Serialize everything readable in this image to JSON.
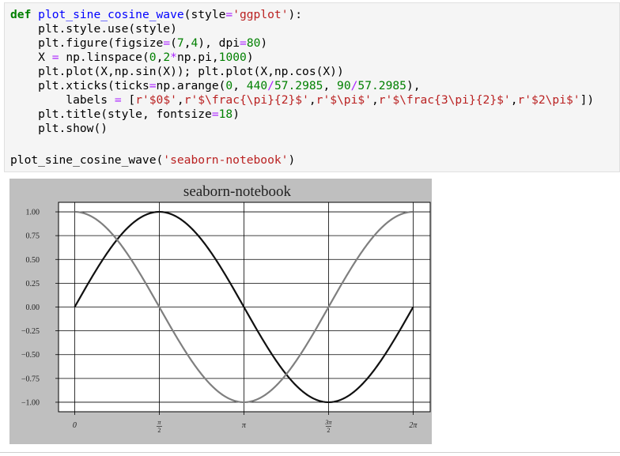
{
  "code_cell": {
    "lines": [
      {
        "indent": "",
        "parts": [
          {
            "cls": "kw",
            "text": "def"
          },
          {
            "cls": "",
            "text": " "
          },
          {
            "cls": "fn",
            "text": "plot_sine_cosine_wave"
          },
          {
            "cls": "",
            "text": "(style"
          },
          {
            "cls": "op",
            "text": "="
          },
          {
            "cls": "str",
            "text": "'ggplot'"
          },
          {
            "cls": "",
            "text": "):"
          }
        ]
      },
      {
        "indent": "    ",
        "parts": [
          {
            "cls": "",
            "text": "plt.style.use(style)"
          }
        ]
      },
      {
        "indent": "    ",
        "parts": [
          {
            "cls": "",
            "text": "plt.figure(figsize"
          },
          {
            "cls": "op",
            "text": "="
          },
          {
            "cls": "",
            "text": "("
          },
          {
            "cls": "num",
            "text": "7"
          },
          {
            "cls": "",
            "text": ","
          },
          {
            "cls": "num",
            "text": "4"
          },
          {
            "cls": "",
            "text": "), dpi"
          },
          {
            "cls": "op",
            "text": "="
          },
          {
            "cls": "num",
            "text": "80"
          },
          {
            "cls": "",
            "text": ")"
          }
        ]
      },
      {
        "indent": "    ",
        "parts": [
          {
            "cls": "",
            "text": "X "
          },
          {
            "cls": "op",
            "text": "="
          },
          {
            "cls": "",
            "text": " np.linspace("
          },
          {
            "cls": "num",
            "text": "0"
          },
          {
            "cls": "",
            "text": ","
          },
          {
            "cls": "num",
            "text": "2"
          },
          {
            "cls": "op",
            "text": "*"
          },
          {
            "cls": "",
            "text": "np.pi,"
          },
          {
            "cls": "num",
            "text": "1000"
          },
          {
            "cls": "",
            "text": ")"
          }
        ]
      },
      {
        "indent": "    ",
        "parts": [
          {
            "cls": "",
            "text": "plt.plot(X,np.sin(X)); plt.plot(X,np.cos(X))"
          }
        ]
      },
      {
        "indent": "    ",
        "parts": [
          {
            "cls": "",
            "text": "plt.xticks(ticks"
          },
          {
            "cls": "op",
            "text": "="
          },
          {
            "cls": "",
            "text": "np.arange("
          },
          {
            "cls": "num",
            "text": "0"
          },
          {
            "cls": "",
            "text": ", "
          },
          {
            "cls": "num",
            "text": "440"
          },
          {
            "cls": "op",
            "text": "/"
          },
          {
            "cls": "num",
            "text": "57.2985"
          },
          {
            "cls": "",
            "text": ", "
          },
          {
            "cls": "num",
            "text": "90"
          },
          {
            "cls": "op",
            "text": "/"
          },
          {
            "cls": "num",
            "text": "57.2985"
          },
          {
            "cls": "",
            "text": "),"
          }
        ]
      },
      {
        "indent": "        ",
        "parts": [
          {
            "cls": "",
            "text": "labels "
          },
          {
            "cls": "op",
            "text": "="
          },
          {
            "cls": "",
            "text": " ["
          },
          {
            "cls": "str",
            "text": "r'$0$'"
          },
          {
            "cls": "",
            "text": ","
          },
          {
            "cls": "str",
            "text": "r'$\\frac{\\pi}{2}$'"
          },
          {
            "cls": "",
            "text": ","
          },
          {
            "cls": "str",
            "text": "r'$\\pi$'"
          },
          {
            "cls": "",
            "text": ","
          },
          {
            "cls": "str",
            "text": "r'$\\frac{3\\pi}{2}$'"
          },
          {
            "cls": "",
            "text": ","
          },
          {
            "cls": "str",
            "text": "r'$2\\pi$'"
          },
          {
            "cls": "",
            "text": "])"
          }
        ]
      },
      {
        "indent": "    ",
        "parts": [
          {
            "cls": "",
            "text": "plt.title(style, fontsize"
          },
          {
            "cls": "op",
            "text": "="
          },
          {
            "cls": "num",
            "text": "18"
          },
          {
            "cls": "",
            "text": ")"
          }
        ]
      },
      {
        "indent": "    ",
        "parts": [
          {
            "cls": "",
            "text": "plt.show()"
          }
        ]
      },
      {
        "indent": "",
        "parts": [
          {
            "cls": "",
            "text": ""
          }
        ]
      },
      {
        "indent": "",
        "parts": [
          {
            "cls": "",
            "text": "plot_sine_cosine_wave("
          },
          {
            "cls": "str",
            "text": "'seaborn-notebook'"
          },
          {
            "cls": "",
            "text": ")"
          }
        ]
      }
    ]
  },
  "chart_data": {
    "type": "line",
    "title": "seaborn-notebook",
    "xlabel": "",
    "ylabel": "",
    "xlim": [
      -0.3,
      6.6
    ],
    "ylim": [
      -1.1,
      1.1
    ],
    "grid": true,
    "x_ticks": [
      0,
      1.5707963,
      3.1415927,
      4.712389,
      6.2831853
    ],
    "x_tick_labels": [
      "0",
      "π/2",
      "π",
      "3π/2",
      "2π"
    ],
    "y_ticks": [
      1.0,
      0.75,
      0.5,
      0.25,
      0.0,
      -0.25,
      -0.5,
      -0.75,
      -1.0
    ],
    "y_tick_labels": [
      "1.00",
      "0.75",
      "0.50",
      "0.25",
      "0.00",
      "−0.25",
      "−0.50",
      "−0.75",
      "−1.00"
    ],
    "series": [
      {
        "function": "sin",
        "color": "#111111",
        "x_range": [
          0,
          6.2831853
        ]
      },
      {
        "function": "cos",
        "color": "#7f7f7f",
        "x_range": [
          0,
          6.2831853
        ]
      }
    ],
    "colors": {
      "figure_bg": "#bfbfbf",
      "axes_bg": "#ffffff",
      "grid": "#000000"
    }
  }
}
